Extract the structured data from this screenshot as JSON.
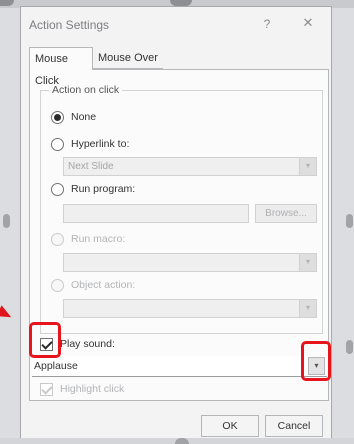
{
  "dialog": {
    "title": "Action Settings",
    "help_glyph": "?",
    "close_glyph": "✕"
  },
  "tabs": [
    {
      "label": "Mouse Click",
      "active": true
    },
    {
      "label": "Mouse Over",
      "active": false
    }
  ],
  "action_group": {
    "label": "Action on click",
    "options": [
      {
        "label": "None",
        "checked": true,
        "enabled": true
      },
      {
        "label": "Hyperlink to:",
        "checked": false,
        "enabled": true
      },
      {
        "label": "Run program:",
        "checked": false,
        "enabled": true
      },
      {
        "label": "Run macro:",
        "checked": false,
        "enabled": false
      },
      {
        "label": "Object action:",
        "checked": false,
        "enabled": false
      }
    ],
    "hyperlink_value": "Next Slide",
    "program_value": "",
    "browse_label": "Browse...",
    "macro_value": "",
    "object_value": ""
  },
  "play_sound": {
    "label": "Play sound:",
    "checked": true
  },
  "sound_select": {
    "value": "Applause"
  },
  "highlight_click": {
    "label": "Highlight click",
    "checked": true,
    "enabled": false
  },
  "buttons": {
    "ok": "OK",
    "cancel": "Cancel"
  },
  "dropdown_glyph": "▾",
  "annotation_color": "#e8141b"
}
